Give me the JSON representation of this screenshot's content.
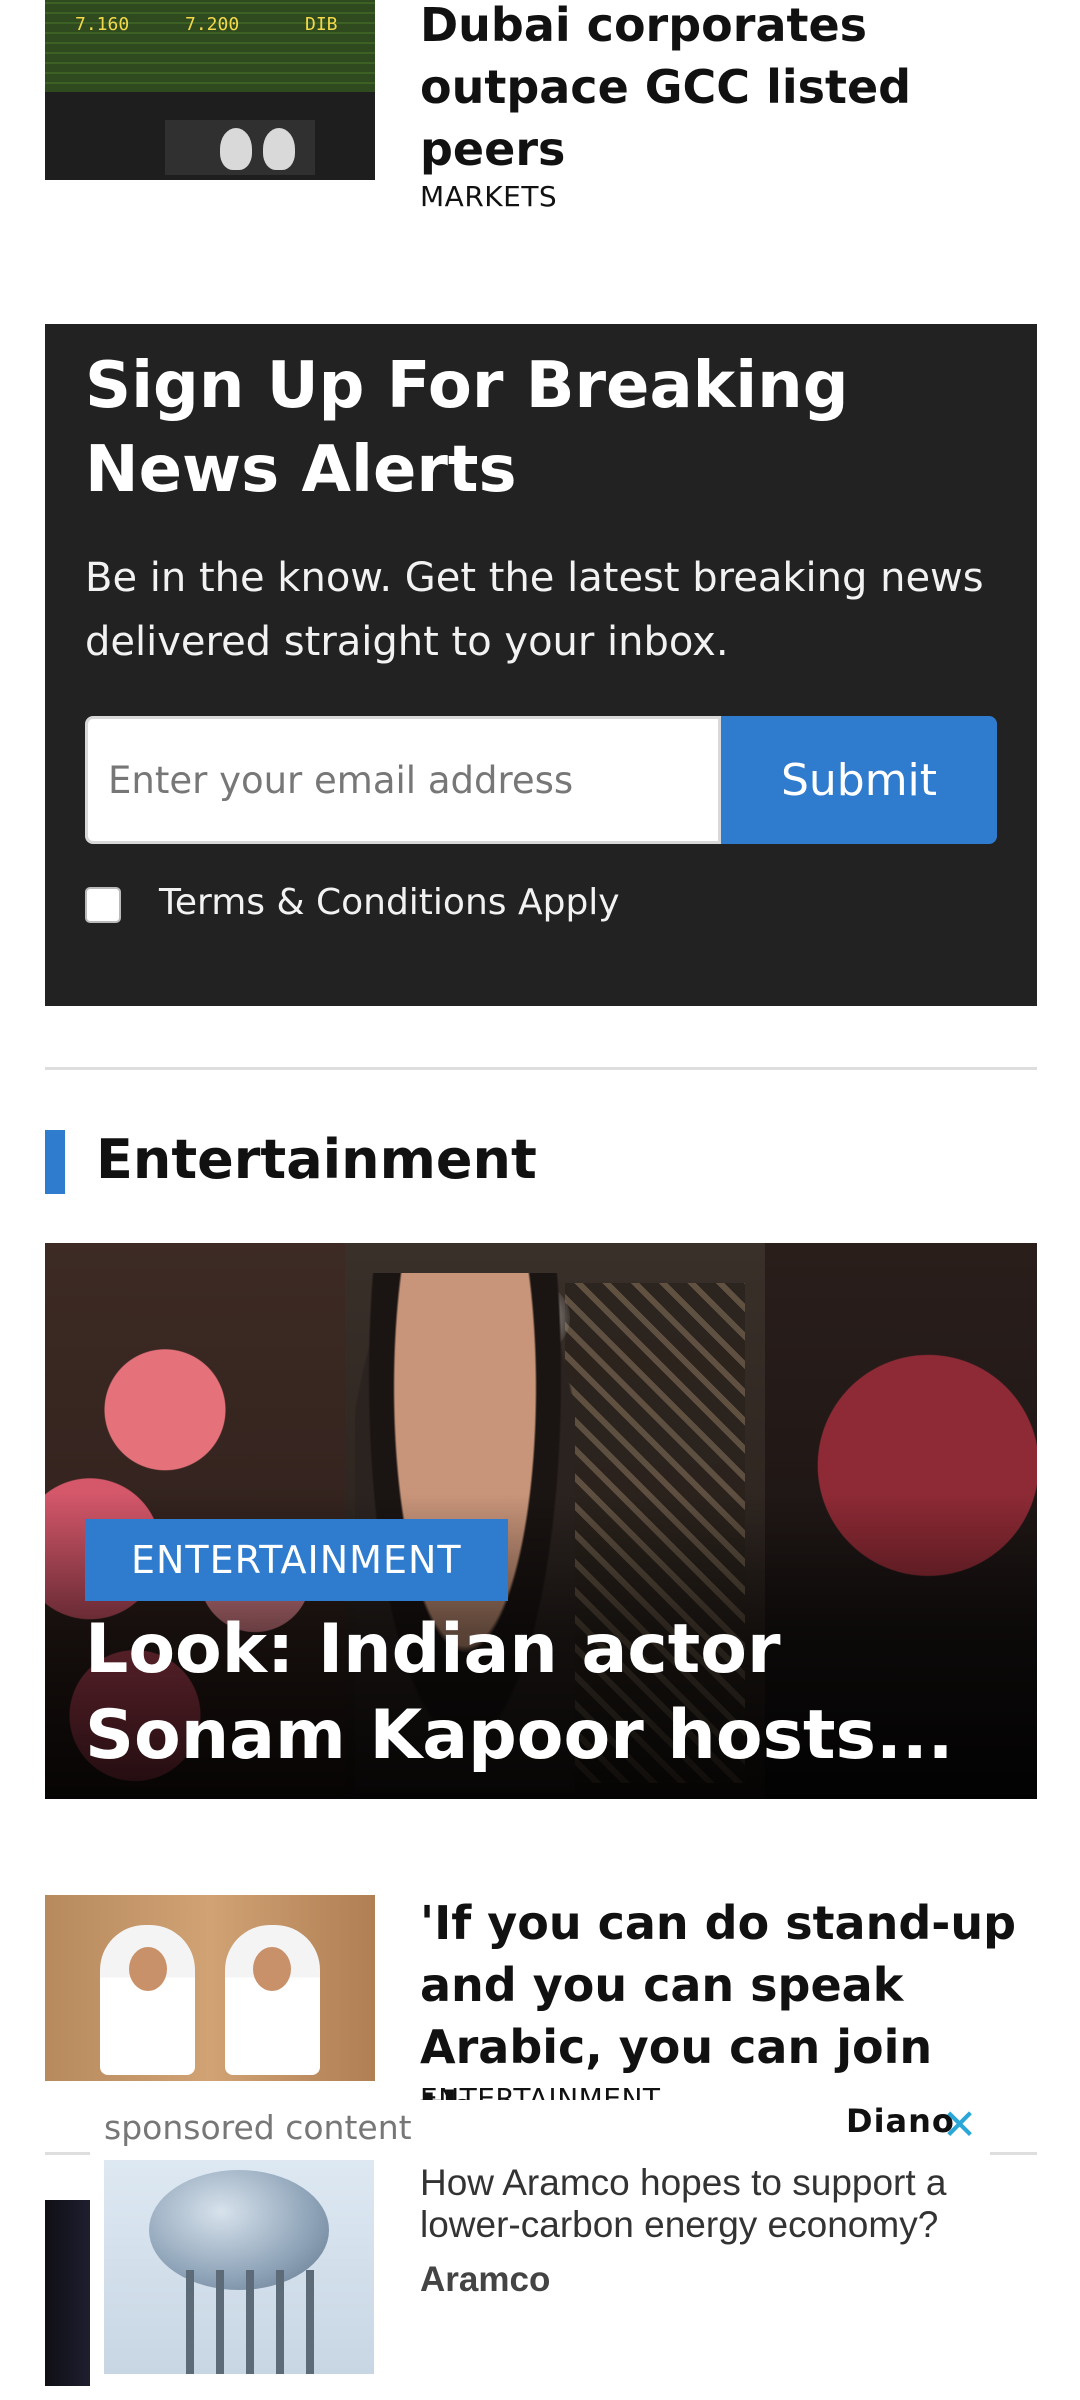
{
  "top_article": {
    "title": "Dubai corporates outpace GCC listed peers",
    "category": "MARKETS",
    "thumb_board": [
      "7.160",
      "7.200",
      "DIB"
    ]
  },
  "signup": {
    "title": "Sign Up For Breaking News Alerts",
    "description": "Be in the know. Get the latest breaking news delivered straight to your inbox.",
    "email_placeholder": "Enter your email address",
    "submit_label": "Submit",
    "terms_label": "Terms & Conditions Apply",
    "terms_checked": false
  },
  "section": {
    "title": "Entertainment",
    "accent_color": "#2f7ccf"
  },
  "featured": {
    "badge": "ENTERTAINMENT",
    "title": "Look: Indian actor Sonam Kapoor hosts..."
  },
  "article2": {
    "title": "'If you can do stand-up and you can speak Arabic, you can join th...",
    "category": "ENTERTAINMENT"
  },
  "ad": {
    "label": "sponsored content",
    "brand": "Diano",
    "close_icon": "close-icon",
    "title": "How Aramco hopes to support a lower-carbon energy economy?",
    "advertiser": "Aramco"
  }
}
